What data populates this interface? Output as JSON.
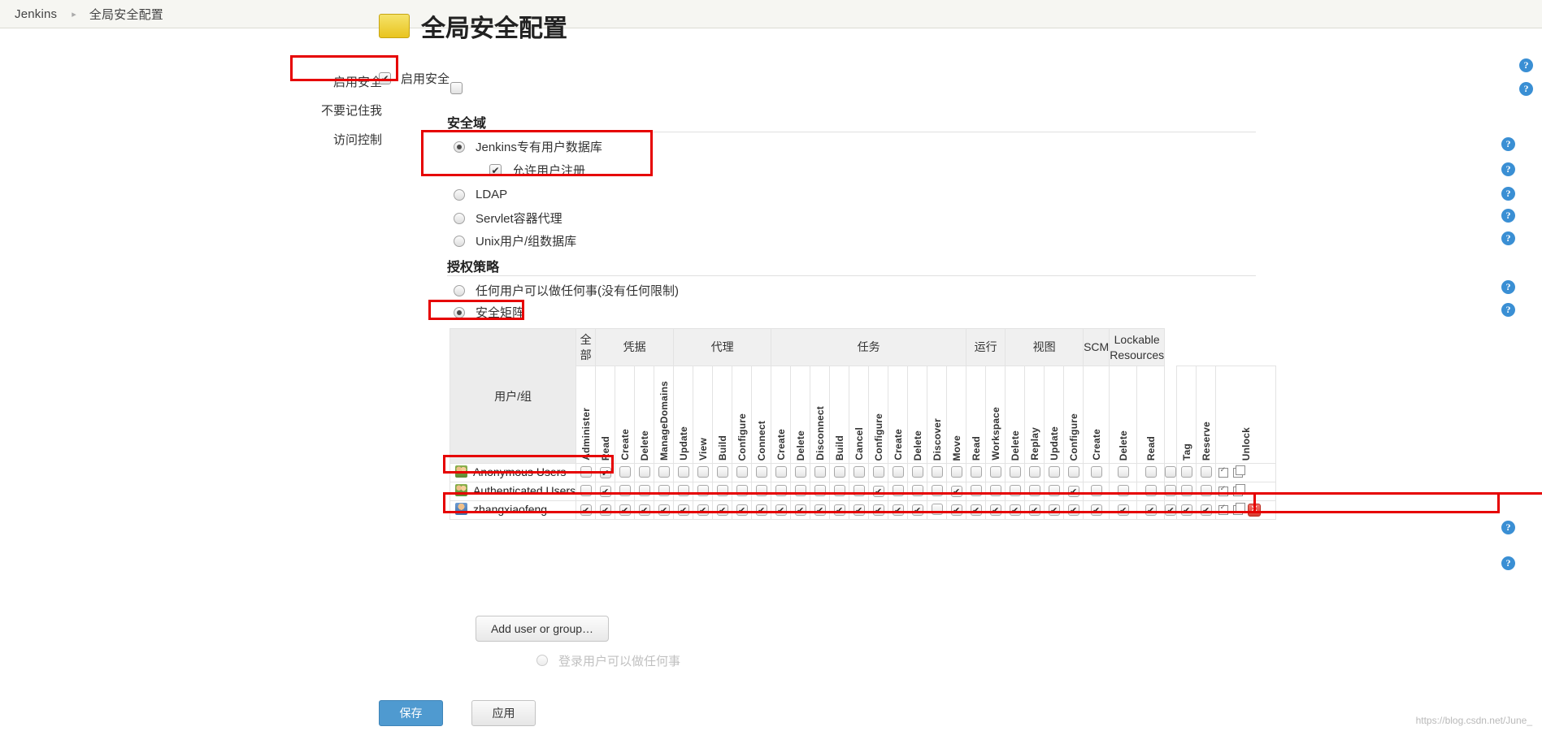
{
  "breadcrumb": {
    "root": "Jenkins",
    "separator": "▸",
    "current": "全局安全配置"
  },
  "page": {
    "title": "全局安全配置",
    "lock_icon": "lock-icon"
  },
  "form": {
    "enable_security_label": "启用安全",
    "enable_security_checked": true,
    "do_not_remember_me_label": "不要记住我",
    "do_not_remember_me_checked": false,
    "access_control_label": "访问控制"
  },
  "security_realm": {
    "heading": "安全域",
    "options": [
      {
        "label": "Jenkins专有用户数据库",
        "selected": true
      },
      {
        "label": "LDAP",
        "selected": false
      },
      {
        "label": "Servlet容器代理",
        "selected": false
      },
      {
        "label": "Unix用户/组数据库",
        "selected": false
      }
    ],
    "sub_option": {
      "label": "允许用户注册",
      "checked": true
    }
  },
  "authorization": {
    "heading": "授权策略",
    "options": [
      {
        "label": "任何用户可以做任何事(没有任何限制)",
        "selected": false
      },
      {
        "label": "安全矩阵",
        "selected": true
      }
    ],
    "clipped_option": {
      "label": "登录用户可以做任何事",
      "selected": false
    }
  },
  "matrix": {
    "user_column_header": "用户/组",
    "groups": [
      {
        "label": "全部",
        "span": 1
      },
      {
        "label": "凭据",
        "span": 4
      },
      {
        "label": "代理",
        "span": 5
      },
      {
        "label": "任务",
        "span": 10
      },
      {
        "label": "运行",
        "span": 2
      },
      {
        "label": "视图",
        "span": 4
      },
      {
        "label": "SCM",
        "span": 1
      },
      {
        "label": "Lockable Resources",
        "span": 2
      }
    ],
    "permissions": [
      "Administer",
      "Read",
      "Create",
      "Delete",
      "ManageDomains",
      "Update",
      "View",
      "Build",
      "Configure",
      "Connect",
      "Create",
      "Delete",
      "Disconnect",
      "Build",
      "Cancel",
      "Configure",
      "Create",
      "Delete",
      "Discover",
      "Move",
      "Read",
      "Workspace",
      "Delete",
      "Replay",
      "Update",
      "Configure",
      "Create",
      "Delete",
      "Read",
      "Tag",
      "Reserve",
      "Unlock"
    ],
    "rows": [
      {
        "name": "Anonymous Users",
        "icon": "group-users-icon",
        "removable": false,
        "checks": [
          false,
          true,
          false,
          false,
          false,
          false,
          false,
          false,
          false,
          false,
          false,
          false,
          false,
          false,
          false,
          false,
          false,
          false,
          false,
          false,
          false,
          false,
          false,
          false,
          false,
          false,
          false,
          false,
          false,
          false,
          false,
          false
        ]
      },
      {
        "name": "Authenticated Users",
        "icon": "group-users-icon",
        "removable": false,
        "checks": [
          false,
          true,
          false,
          false,
          false,
          false,
          false,
          false,
          false,
          false,
          false,
          false,
          false,
          false,
          false,
          true,
          false,
          false,
          false,
          true,
          false,
          false,
          false,
          false,
          false,
          true,
          false,
          false,
          false,
          false,
          false,
          false
        ]
      },
      {
        "name": "zhangxiaofeng",
        "icon": "single-user-icon",
        "removable": true,
        "checks": [
          true,
          true,
          true,
          true,
          true,
          true,
          true,
          true,
          true,
          true,
          true,
          true,
          true,
          true,
          true,
          true,
          true,
          true,
          false,
          true,
          true,
          true,
          true,
          true,
          true,
          true,
          true,
          true,
          true,
          true,
          true,
          true
        ]
      }
    ],
    "row_actions": {
      "check_all": "check-all-icon",
      "uncheck_all": "uncheck-all-icon",
      "remove": "remove-row-icon"
    }
  },
  "buttons": {
    "add_user_or_group": "Add user or group…",
    "save": "保存",
    "apply": "应用"
  },
  "help_icon_label": "?",
  "watermark": "https://blog.csdn.net/June_"
}
